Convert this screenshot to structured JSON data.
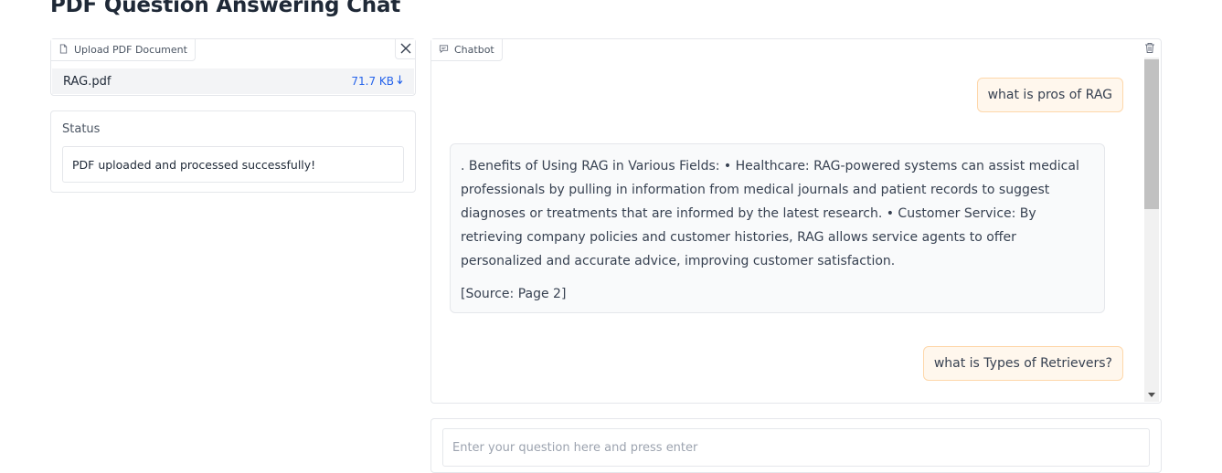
{
  "page": {
    "title": "PDF Question Answering Chat"
  },
  "upload": {
    "label": "Upload PDF Document",
    "file": {
      "name": "RAG.pdf",
      "size": "71.7 KB"
    }
  },
  "status": {
    "label": "Status",
    "value": "PDF uploaded and processed successfully!"
  },
  "chatbot": {
    "label": "Chatbot",
    "messages": [
      {
        "role": "user",
        "text": "what is pros of RAG"
      },
      {
        "role": "bot",
        "text": ". Benefits of Using RAG in Various Fields: • Healthcare: RAG-powered systems can assist medical professionals by pulling in information from medical journals and patient records to suggest diagnoses or treatments that are informed by the latest research. • Customer Service: By retrieving company policies and customer histories, RAG allows service agents to offer personalized and accurate advice, improving customer satisfaction.",
        "source": "[Source: Page 2]"
      },
      {
        "role": "user",
        "text": "what is Types of Retrievers?"
      }
    ]
  },
  "input": {
    "placeholder": "Enter your question here and press enter"
  },
  "icons": {
    "file": "file-icon",
    "chat": "chat-icon",
    "close": "close-icon",
    "trash": "trash-icon",
    "download": "download-arrow-icon"
  }
}
